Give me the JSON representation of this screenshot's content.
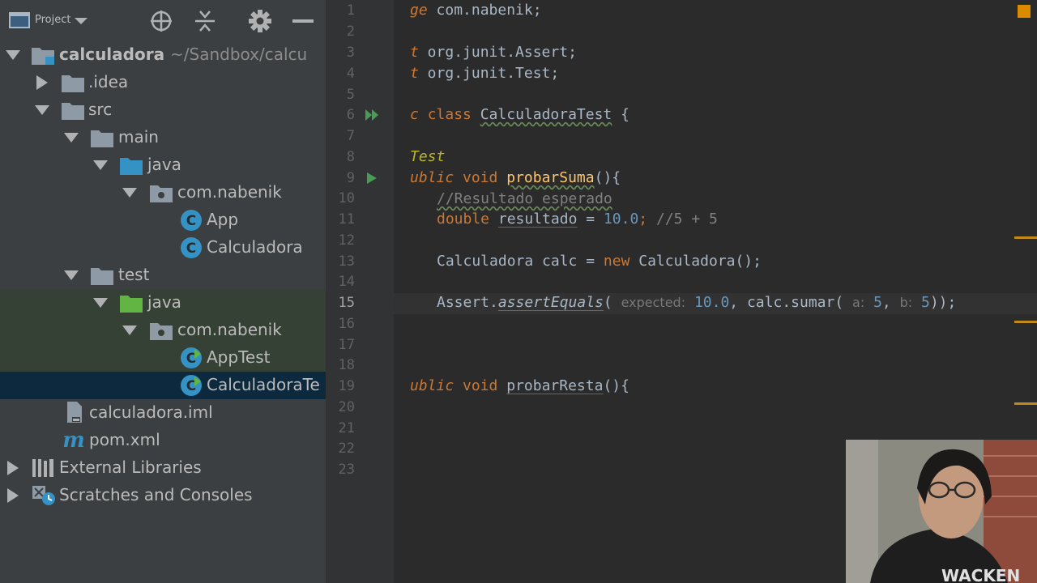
{
  "project_panel": {
    "title": "Project",
    "tree": [
      {
        "label": "calculadora",
        "path": "~/Sandbox/calcu",
        "icon": "module-folder-icon",
        "expanded": true
      },
      {
        "label": ".idea",
        "icon": "folder-icon",
        "expanded": false
      },
      {
        "label": "src",
        "icon": "folder-icon",
        "expanded": true
      },
      {
        "label": "main",
        "icon": "folder-icon",
        "expanded": true
      },
      {
        "label": "java",
        "icon": "source-folder-icon",
        "expanded": true
      },
      {
        "label": "com.nabenik",
        "icon": "package-icon",
        "expanded": true
      },
      {
        "label": "App",
        "icon": "java-class-icon"
      },
      {
        "label": "Calculadora",
        "icon": "java-class-icon"
      },
      {
        "label": "test",
        "icon": "folder-icon",
        "expanded": true
      },
      {
        "label": "java",
        "icon": "test-source-folder-icon",
        "expanded": true
      },
      {
        "label": "com.nabenik",
        "icon": "package-icon",
        "expanded": true
      },
      {
        "label": "AppTest",
        "icon": "java-test-class-icon"
      },
      {
        "label": "CalculadoraTe",
        "icon": "java-test-class-icon",
        "selected": true
      },
      {
        "label": "calculadora.iml",
        "icon": "iml-file-icon"
      },
      {
        "label": "pom.xml",
        "icon": "maven-icon"
      },
      {
        "label": "External Libraries",
        "icon": "libraries-icon",
        "expanded": false
      },
      {
        "label": "Scratches and Consoles",
        "icon": "scratches-icon",
        "expanded": false
      }
    ]
  },
  "editor": {
    "line_numbers": [
      "1",
      "2",
      "3",
      "4",
      "5",
      "6",
      "7",
      "8",
      "9",
      "10",
      "11",
      "12",
      "13",
      "14",
      "15",
      "16",
      "17",
      "18",
      "19",
      "20",
      "21",
      "22",
      "23"
    ],
    "current_line": "15",
    "code": {
      "l1_kw": "ge",
      "l1_rest": " com.nabenik;",
      "l3_kw": "t",
      "l3_rest": " org.junit.Assert;",
      "l4_kw": "t",
      "l4_rest": " org.junit.Test;",
      "l6_kw1": "c",
      "l6_kw2": "class",
      "l6_name": "CalculadoraTest",
      "l6_rest": " {",
      "l8_ann": "Test",
      "l9_kw1": "ublic",
      "l9_kw2": "void",
      "l9_fn": "probarSuma",
      "l9_rest": "(){",
      "l10_cmt": "//Resultado esperado",
      "l11_kw": "double",
      "l11_var": "resultado",
      "l11_eq": " = ",
      "l11_num": "10.0",
      "l11_semi": ";",
      "l11_cmt": " //5 + 5",
      "l13_a": "Calculadora calc = ",
      "l13_kw": "new",
      "l13_b": " Calculadora();",
      "l15_a": "Assert.",
      "l15_method": "assertEquals",
      "l15_paren": "(",
      "l15_hint1": "expected:",
      "l15_num1": "10.0",
      "l15_b": ", calc.sumar(",
      "l15_hint2": "a:",
      "l15_num2": "5",
      "l15_comma": ",",
      "l15_hint3": "b:",
      "l15_num3": "5",
      "l15_end": "));",
      "l19_kw1": "ublic",
      "l19_kw2": "void",
      "l19_fn": "probarResta",
      "l19_rest": "(){"
    }
  },
  "colors": {
    "panel_bg": "#3c3f41",
    "editor_bg": "#2b2b2b",
    "selection": "#0d293e",
    "test_bg": "#364135",
    "keyword": "#cc7832",
    "function": "#ffc66d",
    "number": "#6897bb"
  }
}
